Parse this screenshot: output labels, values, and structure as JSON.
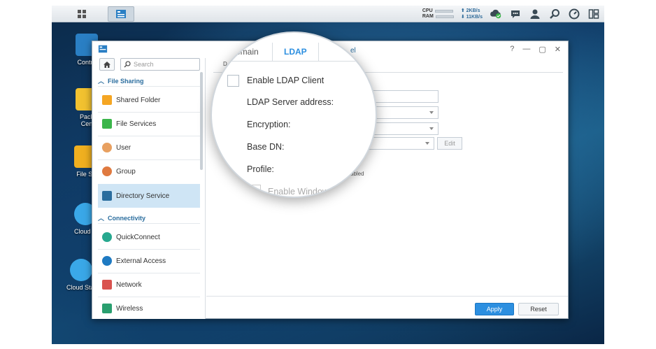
{
  "taskbar": {
    "cpu_label": "CPU",
    "ram_label": "RAM",
    "upload": "2KB/s",
    "download": "11KB/s"
  },
  "desktop": {
    "icons": [
      {
        "label": "Contro"
      },
      {
        "label": "Pack\nCen"
      },
      {
        "label": "File St"
      },
      {
        "label": "Cloud S"
      },
      {
        "label": "Cloud Stat"
      }
    ]
  },
  "window": {
    "controls": {
      "help": "?",
      "minimize": "—",
      "maximize": "▢",
      "close": "✕"
    }
  },
  "sidebar": {
    "search_placeholder": "Search",
    "sections": [
      {
        "label": "File Sharing"
      },
      {
        "label": "Connectivity"
      }
    ],
    "items": [
      {
        "label": "Shared Folder",
        "color": "#f5a623"
      },
      {
        "label": "File Services",
        "color": "#3bb54a"
      },
      {
        "label": "User",
        "color": "#e8a060"
      },
      {
        "label": "Group",
        "color": "#e07a40"
      },
      {
        "label": "Directory Service",
        "color": "#2a6d9e"
      },
      {
        "label": "QuickConnect",
        "color": "#27a88f"
      },
      {
        "label": "External Access",
        "color": "#1f7ac2"
      },
      {
        "label": "Network",
        "color": "#d9534f"
      },
      {
        "label": "Wireless",
        "color": "#2a9f6f"
      }
    ]
  },
  "content": {
    "tab_fragment_left": "D",
    "tab_fragment_right": "el",
    "edit_label": "Edit",
    "enabled_fragment": "abled",
    "apply_label": "Apply",
    "reset_label": "Reset"
  },
  "magnifier": {
    "tabs": {
      "domain": "omain",
      "ldap": "LDAP"
    },
    "enable_ldap": "Enable LDAP Client",
    "server_address": "LDAP Server address:",
    "encryption": "Encryption:",
    "base_dn": "Base DN:",
    "profile": "Profile:",
    "enable_windows": "Enable Window"
  }
}
